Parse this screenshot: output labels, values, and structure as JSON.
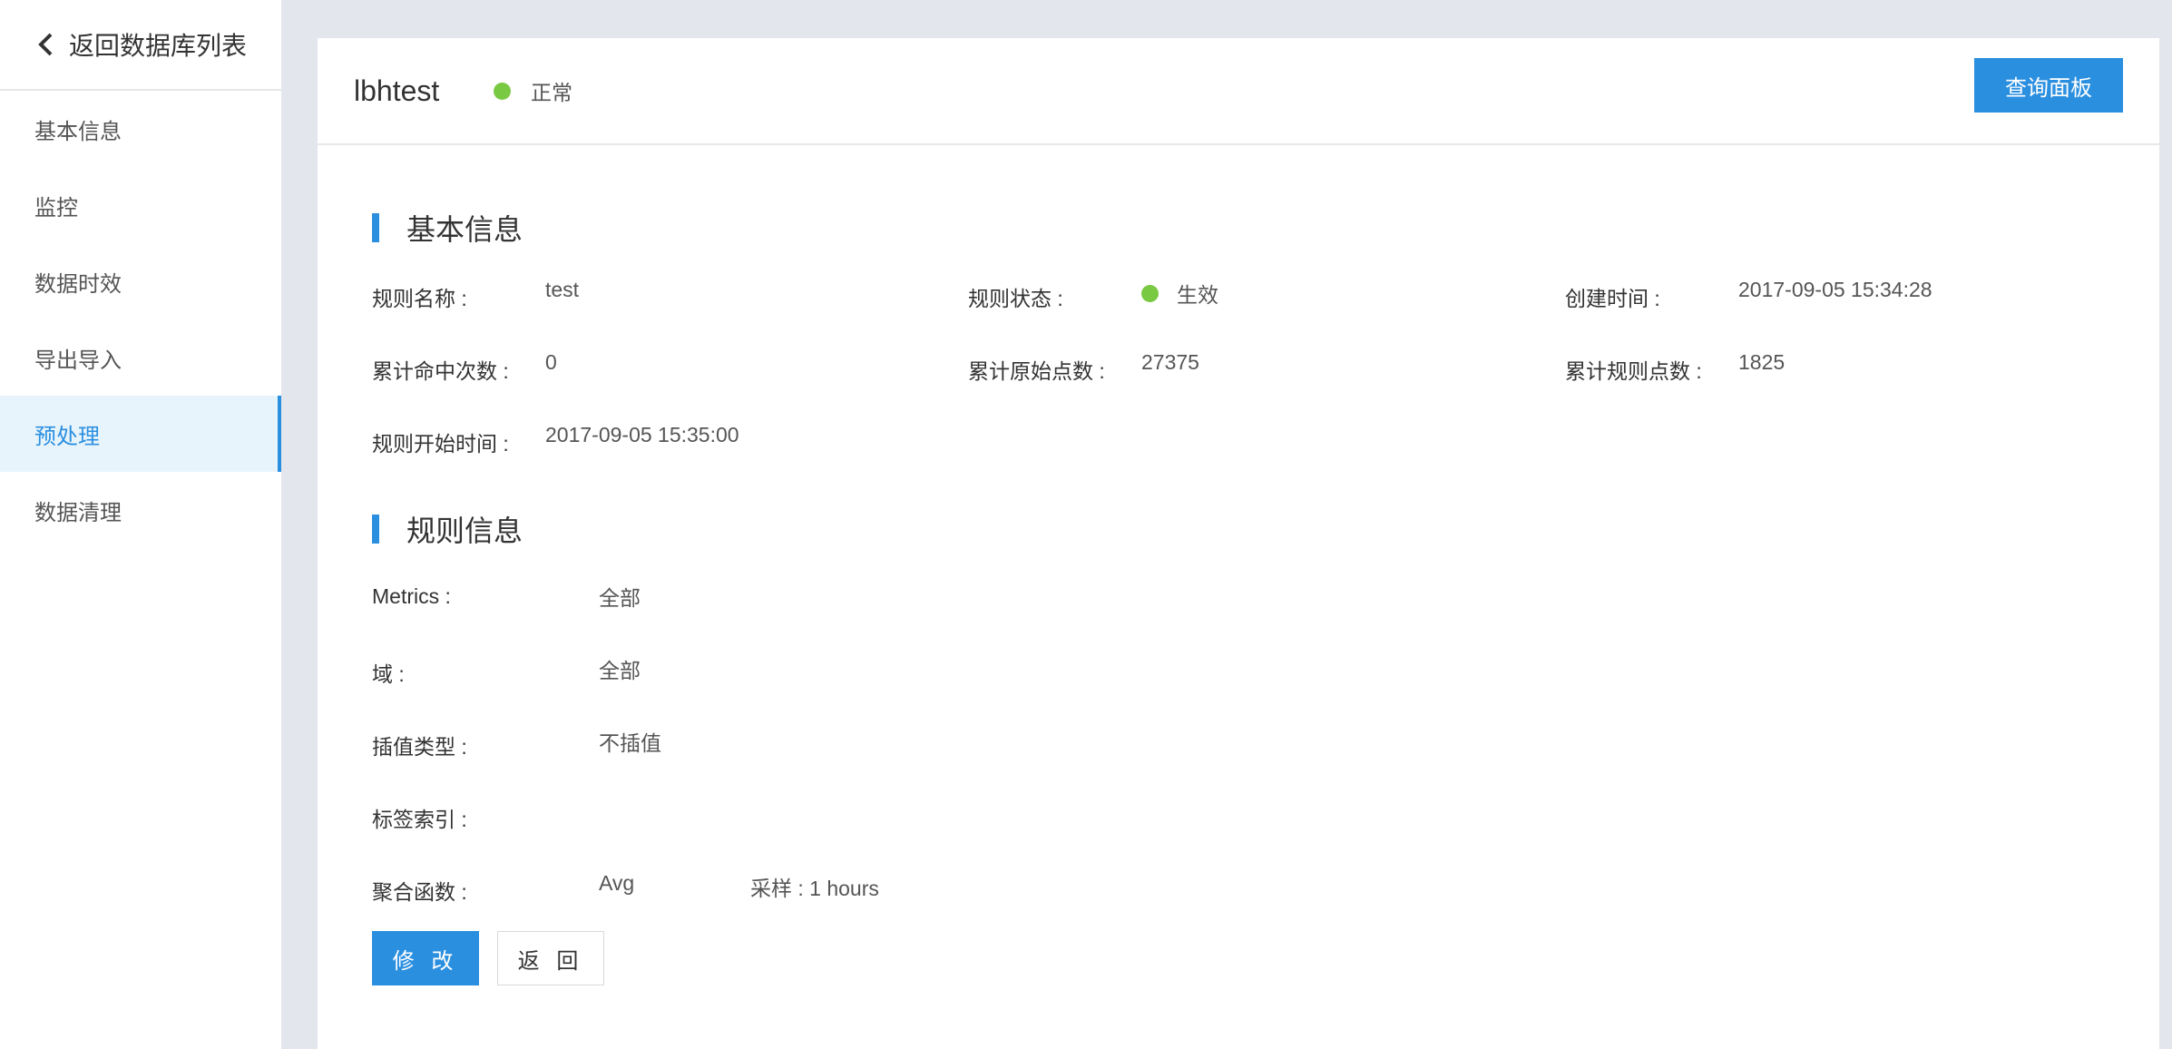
{
  "sidebar": {
    "back_label": "返回数据库列表",
    "items": [
      {
        "label": "基本信息"
      },
      {
        "label": "监控"
      },
      {
        "label": "数据时效"
      },
      {
        "label": "导出导入"
      },
      {
        "label": "预处理",
        "active": true
      },
      {
        "label": "数据清理"
      }
    ]
  },
  "header": {
    "db_name": "lbhtest",
    "status": "正常",
    "status_color": "#7ac943",
    "query_button": "查询面板"
  },
  "basic_info": {
    "title": "基本信息",
    "rule_name_label": "规则名称 :",
    "rule_name": "test",
    "rule_status_label": "规则状态 :",
    "rule_status": "生效",
    "created_label": "创建时间 :",
    "created": "2017-09-05 15:34:28",
    "hit_count_label": "累计命中次数 :",
    "hit_count": "0",
    "raw_points_label": "累计原始点数 :",
    "raw_points": "27375",
    "rule_points_label": "累计规则点数 :",
    "rule_points": "1825",
    "start_time_label": "规则开始时间 :",
    "start_time": "2017-09-05 15:35:00"
  },
  "rule_info": {
    "title": "规则信息",
    "metrics_label": "Metrics :",
    "metrics": "全部",
    "domain_label": "域 :",
    "domain": "全部",
    "interp_label": "插值类型 :",
    "interp": "不插值",
    "tag_index_label": "标签索引 :",
    "tag_index": "",
    "agg_label": "聚合函数 :",
    "agg": "Avg",
    "sample": "采样 : 1 hours"
  },
  "actions": {
    "edit": "修 改",
    "back": "返 回"
  },
  "colors": {
    "accent": "#2b8fe0",
    "status_green": "#7ac943"
  }
}
